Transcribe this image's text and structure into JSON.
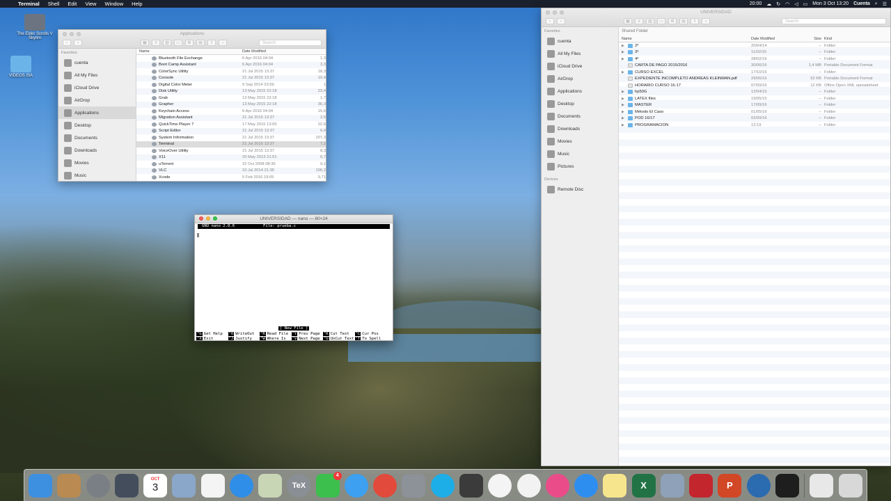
{
  "menubar": {
    "app": "Terminal",
    "menus": [
      "Shell",
      "Edit",
      "View",
      "Window",
      "Help"
    ],
    "clock": "Mon 3 Oct 13:20",
    "user": "Cuenta",
    "battery_time": "20:00"
  },
  "desktop": {
    "icons": [
      {
        "label": "The Elder Scrolls V Skyrim"
      },
      {
        "label": "VIDEOS ISA"
      }
    ]
  },
  "finder_apps": {
    "title": "Applications",
    "search_placeholder": "Search",
    "sidebar_heading": "Favorites",
    "sidebar": [
      "cuenta",
      "All My Files",
      "iCloud Drive",
      "AirDrop",
      "Applications",
      "Desktop",
      "Documents",
      "Downloads",
      "Movies",
      "Music"
    ],
    "col_name": "Name",
    "col_date": "Date Modified",
    "rows": [
      {
        "name": "Bluetooth File Exchange",
        "date": "6 Apr 2016 04:04",
        "size": "1,3"
      },
      {
        "name": "Boot Camp Assistant",
        "date": "6 Apr 2016 04:04",
        "size": "3,3"
      },
      {
        "name": "ColorSync Utility",
        "date": "21 Jul 2015 13:37",
        "size": "18,3"
      },
      {
        "name": "Console",
        "date": "21 Jul 2015 13:37",
        "size": "10,4"
      },
      {
        "name": "Digital Color Meter",
        "date": "9 Sep 2014 23:59",
        "size": "1"
      },
      {
        "name": "Disk Utility",
        "date": "13 May 2015 22:18",
        "size": "23,4"
      },
      {
        "name": "Grab",
        "date": "13 May 2015 22:18",
        "size": "1,7"
      },
      {
        "name": "Grapher",
        "date": "13 May 2015 22:18",
        "size": "36,3"
      },
      {
        "name": "Keychain Access",
        "date": "6 Apr 2016 04:04",
        "size": "15,6"
      },
      {
        "name": "Migration Assistant",
        "date": "21 Jul 2015 13:37",
        "size": "2,5"
      },
      {
        "name": "QuickTime Player 7",
        "date": "17 May 2015 13:05",
        "size": "22,6"
      },
      {
        "name": "Script Editor",
        "date": "21 Jul 2015 13:37",
        "size": "6,4"
      },
      {
        "name": "System Information",
        "date": "21 Jul 2015 13:37",
        "size": "207,3"
      },
      {
        "name": "Terminal",
        "date": "21 Jul 2015 13:37",
        "size": "7,2"
      },
      {
        "name": "VoiceOver Utility",
        "date": "21 Jul 2015 13:37",
        "size": "8,3"
      },
      {
        "name": "X11",
        "date": "20 May 2013 21:51",
        "size": "6,7"
      },
      {
        "name": "uTorrent",
        "date": "22 Oct 2008 08:36",
        "size": "9,1"
      },
      {
        "name": "VLC",
        "date": "10 Jul 2014 21:35",
        "size": "106,2"
      },
      {
        "name": "Xcode",
        "date": "5 Feb 2016 19:05",
        "size": "9,71"
      }
    ]
  },
  "finder_uni": {
    "title": "UNIVERSIDAD",
    "search_placeholder": "Search",
    "header": "Shared Folder",
    "sidebar_heading": "Favorites",
    "sidebar": [
      "cuenta",
      "All My Files",
      "iCloud Drive",
      "AirDrop",
      "Applications",
      "Desktop",
      "Documents",
      "Downloads",
      "Movies",
      "Music",
      "Pictures"
    ],
    "devices_heading": "Devices",
    "devices": [
      "Remote Disc"
    ],
    "cols": {
      "name": "Name",
      "date": "Date Modified",
      "size": "Size",
      "kind": "Kind"
    },
    "rows": [
      {
        "name": "2º",
        "date": "20/04/14",
        "size": "--",
        "kind": "Folder",
        "type": "folder"
      },
      {
        "name": "3º",
        "date": "11/02/15",
        "size": "--",
        "kind": "Folder",
        "type": "folder"
      },
      {
        "name": "4º",
        "date": "28/02/16",
        "size": "--",
        "kind": "Folder",
        "type": "folder"
      },
      {
        "name": "CARTA DE PAGO 2015/2016",
        "date": "30/06/16",
        "size": "1,4 MB",
        "kind": "Portable Document Format",
        "type": "doc"
      },
      {
        "name": "CURSO EXCEL",
        "date": "17/10/15",
        "size": "--",
        "kind": "Folder",
        "type": "folder"
      },
      {
        "name": "EXPEDIENTE INCOMPLETO ANDREAS KLEINMAN.pdf",
        "date": "29/06/16",
        "size": "52 KB",
        "kind": "Portable Document Format",
        "type": "doc"
      },
      {
        "name": "HORARIO CURSO 16-17",
        "date": "07/09/16",
        "size": "12 KB",
        "kind": "Office Open XML spreadsheet",
        "type": "doc"
      },
      {
        "name": "hp50G",
        "date": "12/04/15",
        "size": "--",
        "kind": "Folder",
        "type": "folder"
      },
      {
        "name": "LATEX files",
        "date": "19/05/15",
        "size": "--",
        "kind": "Folder",
        "type": "folder"
      },
      {
        "name": "MASTER",
        "date": "17/09/16",
        "size": "--",
        "kind": "Folder",
        "type": "folder"
      },
      {
        "name": "Método El Caso",
        "date": "01/05/16",
        "size": "--",
        "kind": "Folder",
        "type": "folder"
      },
      {
        "name": "POD 16/17",
        "date": "02/09/16",
        "size": "--",
        "kind": "Folder",
        "type": "folder"
      },
      {
        "name": "PROGRAMACIÓN",
        "date": "13:19",
        "size": "--",
        "kind": "Folder",
        "type": "folder"
      }
    ]
  },
  "terminal": {
    "title": "UNIVERSIDAD — nano — 80×24",
    "nano_version": "GNU nano 2.0.6",
    "file": "File: prueba.c",
    "status": "[ New File ]",
    "shortcuts": [
      {
        "key": "^G",
        "label": "Get Help"
      },
      {
        "key": "^O",
        "label": "WriteOut"
      },
      {
        "key": "^R",
        "label": "Read File"
      },
      {
        "key": "^Y",
        "label": "Prev Page"
      },
      {
        "key": "^K",
        "label": "Cut Text"
      },
      {
        "key": "^C",
        "label": "Cur Pos"
      },
      {
        "key": "^X",
        "label": "Exit"
      },
      {
        "key": "^J",
        "label": "Justify"
      },
      {
        "key": "^W",
        "label": "Where Is"
      },
      {
        "key": "^V",
        "label": "Next Page"
      },
      {
        "key": "^U",
        "label": "UnCut Text"
      },
      {
        "key": "^T",
        "label": "To Spell"
      }
    ]
  },
  "dock": {
    "calendar_day": "3",
    "calendar_month": "OCT",
    "facetime_badge": "4",
    "tex_label": "TeX",
    "excel_label": "X",
    "ppt_label": "P",
    "apps": [
      {
        "name": "finder",
        "color": "#3d8fe0"
      },
      {
        "name": "notebook",
        "color": "#b98a52"
      },
      {
        "name": "launchpad",
        "color": "#7a7f86"
      },
      {
        "name": "mission-control",
        "color": "#444d5c"
      },
      {
        "name": "calendar",
        "color": "#ffffff"
      },
      {
        "name": "preview",
        "color": "#8aa7c9"
      },
      {
        "name": "reminders",
        "color": "#f4f4f4"
      },
      {
        "name": "safari",
        "color": "#2f8ee8"
      },
      {
        "name": "photo-browser",
        "color": "#c9d6b6"
      },
      {
        "name": "tex",
        "color": "#8a8f95"
      },
      {
        "name": "facetime",
        "color": "#3dbf4e"
      },
      {
        "name": "messages",
        "color": "#3da0f0"
      },
      {
        "name": "chrome",
        "color": "#e24a3b"
      },
      {
        "name": "system-preferences",
        "color": "#8d9299"
      },
      {
        "name": "skype",
        "color": "#1daee8"
      },
      {
        "name": "final-cut",
        "color": "#3b3b3b"
      },
      {
        "name": "photos",
        "color": "#f4f4f4"
      },
      {
        "name": "clock",
        "color": "#f2f2f2"
      },
      {
        "name": "itunes",
        "color": "#ea4c89"
      },
      {
        "name": "app-store",
        "color": "#2e8ef0"
      },
      {
        "name": "notes",
        "color": "#f6e58d"
      },
      {
        "name": "excel",
        "color": "#217346"
      },
      {
        "name": "image-capture",
        "color": "#8ea1b8"
      },
      {
        "name": "autocad",
        "color": "#c4262e"
      },
      {
        "name": "powerpoint",
        "color": "#d24726"
      },
      {
        "name": "quicktime",
        "color": "#2b6bb0"
      },
      {
        "name": "terminal",
        "color": "#1e1e1e"
      },
      {
        "name": "downloads-stack",
        "color": "#e8e8e8"
      },
      {
        "name": "trash",
        "color": "#d8d8d8"
      }
    ]
  }
}
